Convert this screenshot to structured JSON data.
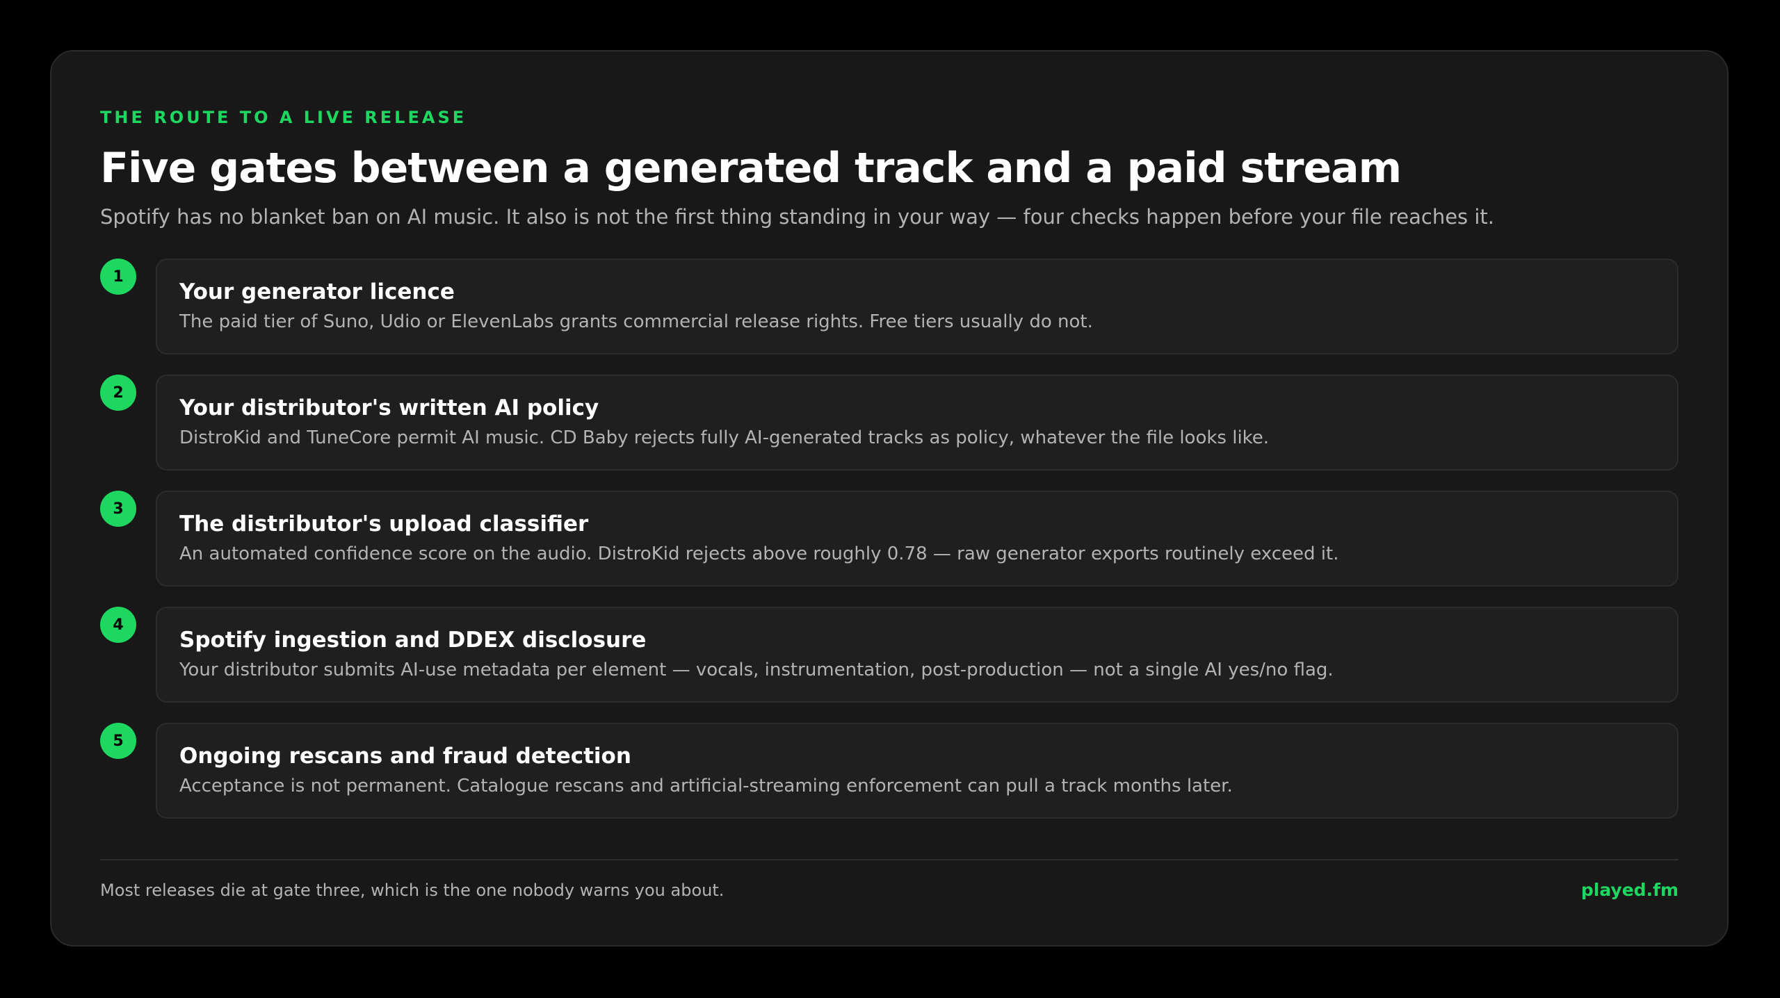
{
  "header": {
    "eyebrow": "THE ROUTE TO A LIVE RELEASE",
    "title": "Five gates between a generated track and a paid stream",
    "subtitle": "Spotify has no blanket ban on AI music. It also is not the first thing standing in your way — four checks happen before your file reaches it."
  },
  "steps": [
    {
      "number": "1",
      "title": "Your generator licence",
      "description": "The paid tier of Suno, Udio or ElevenLabs grants commercial release rights. Free tiers usually do not."
    },
    {
      "number": "2",
      "title": "Your distributor's written AI policy",
      "description": "DistroKid and TuneCore permit AI music. CD Baby rejects fully AI-generated tracks as policy, whatever the file looks like."
    },
    {
      "number": "3",
      "title": "The distributor's upload classifier",
      "description": "An automated confidence score on the audio. DistroKid rejects above roughly 0.78 — raw generator exports routinely exceed it."
    },
    {
      "number": "4",
      "title": "Spotify ingestion and DDEX disclosure",
      "description": "Your distributor submits AI-use metadata per element — vocals, instrumentation, post-production — not a single AI yes/no flag."
    },
    {
      "number": "5",
      "title": "Ongoing rescans and fraud detection",
      "description": "Acceptance is not permanent. Catalogue rescans and artificial-streaming enforcement can pull a track months later."
    }
  ],
  "footer": {
    "note": "Most releases die at gate three, which is the one nobody warns you about.",
    "brand": "played.fm"
  },
  "colors": {
    "accent": "#1ed760",
    "background": "#000000",
    "card": "#181818",
    "step_box": "#1f1f1f",
    "text_primary": "#ffffff",
    "text_secondary": "#b3b3b3"
  }
}
